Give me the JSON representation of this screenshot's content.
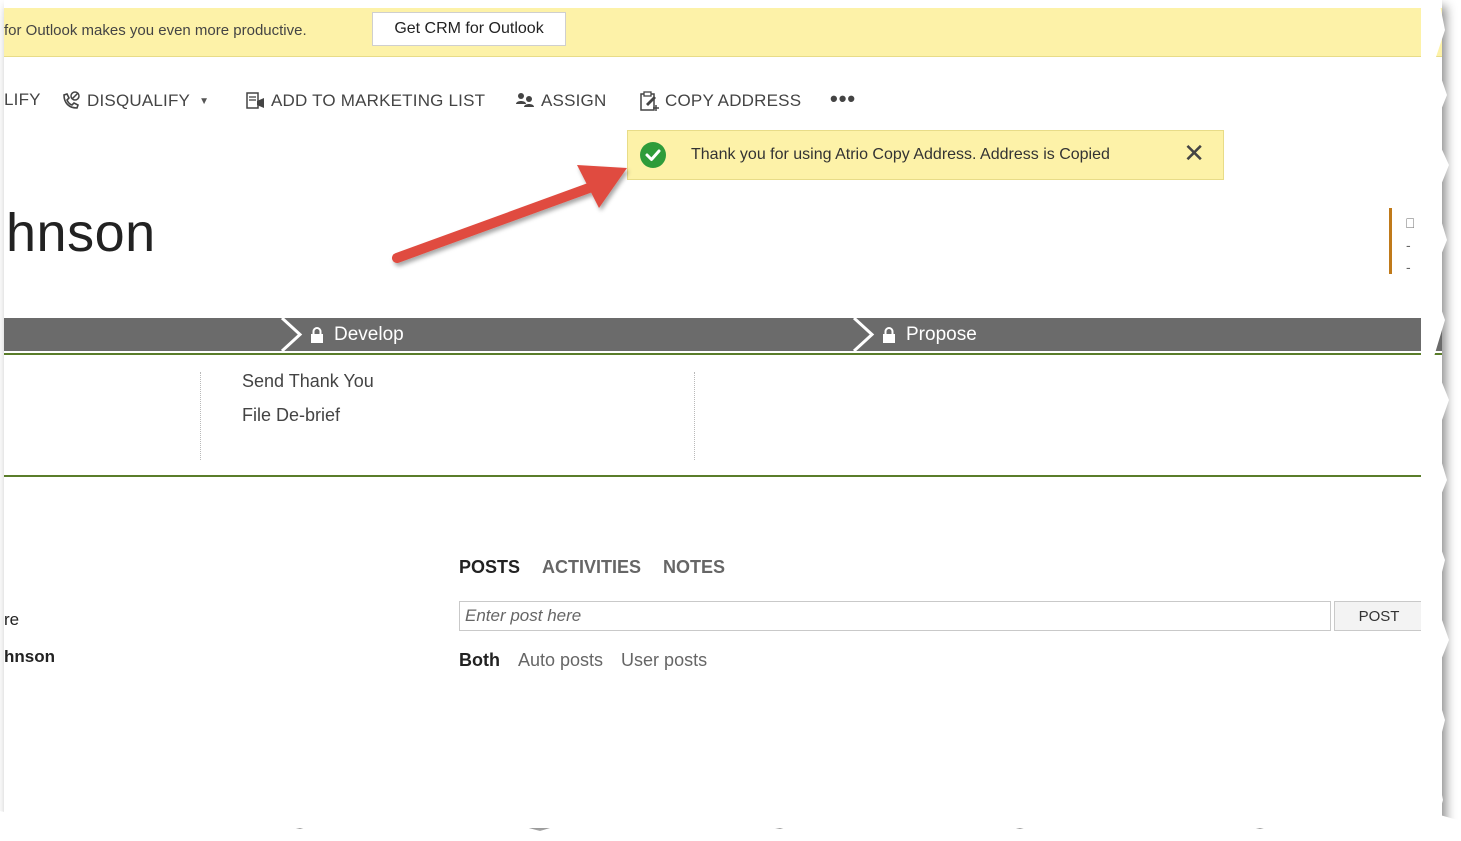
{
  "banner": {
    "text": "for Outlook makes you even more productive.",
    "button_label": "Get CRM for Outlook"
  },
  "toolbar": {
    "qualify_label": "LIFY",
    "disqualify_label": "DISQUALIFY",
    "marketing_label": "ADD TO MARKETING LIST",
    "assign_label": "ASSIGN",
    "copy_label": "COPY ADDRESS",
    "more_label": "•••"
  },
  "toast": {
    "message": "Thank you for using Atrio Copy Address. Address is Copied",
    "close": "✕"
  },
  "record": {
    "title": "hnson"
  },
  "process": {
    "stages": [
      {
        "label": "Develop"
      },
      {
        "label": "Propose"
      }
    ],
    "steps": [
      "Send Thank You",
      "File De-brief"
    ]
  },
  "social": {
    "tabs": [
      "POSTS",
      "ACTIVITIES",
      "NOTES"
    ],
    "post_placeholder": "Enter post here",
    "post_button": "POST",
    "filters": [
      "Both",
      "Auto posts",
      "User posts"
    ]
  },
  "left_fields": [
    "re",
    "hnson"
  ],
  "colors": {
    "banner": "#fdf2a8",
    "success": "#2e9c3a",
    "process_bar": "#6b6b6b",
    "process_line": "#5a7d2a",
    "arrow": "#e04b3f",
    "side_accent": "#c07a1a"
  }
}
